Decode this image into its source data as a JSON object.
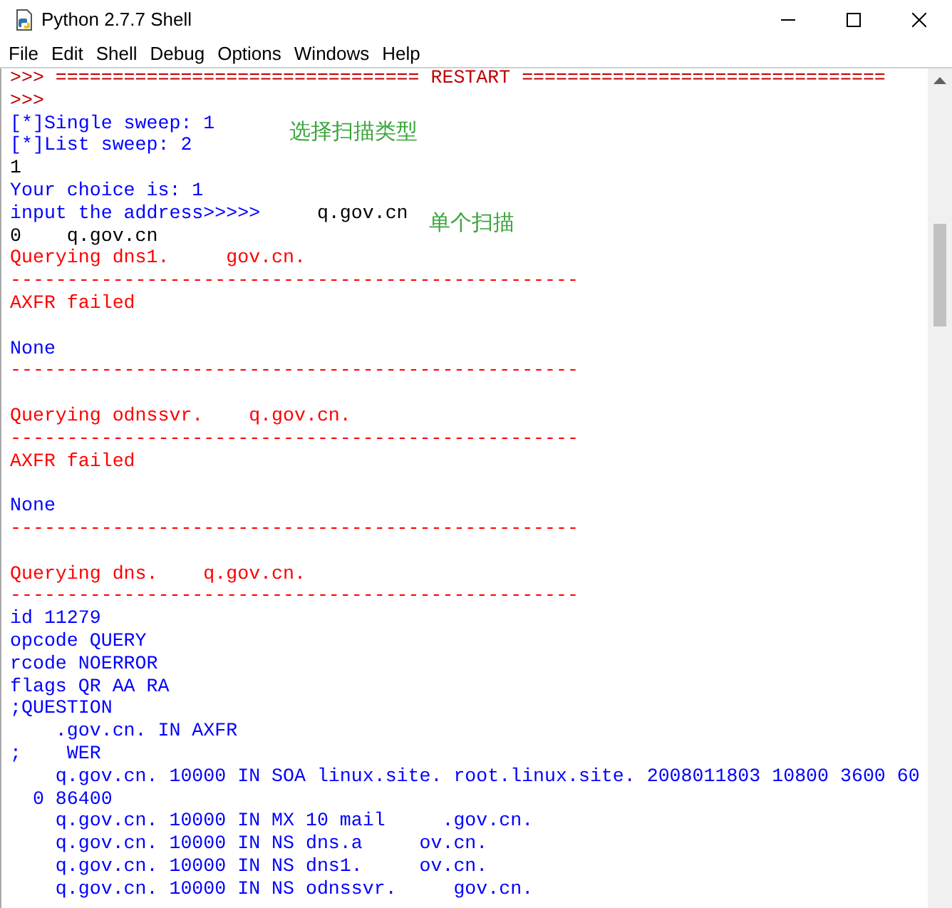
{
  "window": {
    "title": "Python 2.7.7 Shell"
  },
  "menu": [
    {
      "label": "File"
    },
    {
      "label": "Edit"
    },
    {
      "label": "Shell"
    },
    {
      "label": "Debug"
    },
    {
      "label": "Options"
    },
    {
      "label": "Windows"
    },
    {
      "label": "Help"
    }
  ],
  "lines": [
    {
      "segments": [
        {
          "kind": "prompt",
          "text": ">>> ================================ RESTART ================================"
        }
      ]
    },
    {
      "segments": [
        {
          "kind": "prompt",
          "text": ">>>"
        }
      ]
    },
    {
      "segments": [
        {
          "kind": "stdout",
          "text": "[*]Single sweep: 1"
        }
      ]
    },
    {
      "segments": [
        {
          "kind": "stdout",
          "text": "[*]List sweep: 2"
        }
      ]
    },
    {
      "segments": [
        {
          "kind": "input",
          "text": "1"
        }
      ]
    },
    {
      "segments": [
        {
          "kind": "stdout",
          "text": "Your choice is: 1"
        }
      ]
    },
    {
      "segments": [
        {
          "kind": "stdout",
          "text": "input the address>>>>> "
        },
        {
          "kind": "input",
          "text": "    q.gov.cn"
        }
      ]
    },
    {
      "segments": [
        {
          "kind": "input",
          "text": "0    q.gov.cn"
        }
      ]
    },
    {
      "segments": [
        {
          "kind": "stderr",
          "text": "Querying dns1.     gov.cn."
        }
      ]
    },
    {
      "segments": [
        {
          "kind": "stderr",
          "text": "--------------------------------------------------"
        }
      ]
    },
    {
      "segments": [
        {
          "kind": "stderr",
          "text": "AXFR failed"
        }
      ]
    },
    {
      "kind": "blank"
    },
    {
      "segments": [
        {
          "kind": "stdout",
          "text": "None"
        }
      ]
    },
    {
      "segments": [
        {
          "kind": "stderr",
          "text": "--------------------------------------------------"
        }
      ]
    },
    {
      "kind": "blank"
    },
    {
      "segments": [
        {
          "kind": "stderr",
          "text": "Querying odnssvr.    q.gov.cn."
        }
      ]
    },
    {
      "segments": [
        {
          "kind": "stderr",
          "text": "--------------------------------------------------"
        }
      ]
    },
    {
      "segments": [
        {
          "kind": "stderr",
          "text": "AXFR failed"
        }
      ]
    },
    {
      "kind": "blank"
    },
    {
      "segments": [
        {
          "kind": "stdout",
          "text": "None"
        }
      ]
    },
    {
      "segments": [
        {
          "kind": "stderr",
          "text": "--------------------------------------------------"
        }
      ]
    },
    {
      "kind": "blank"
    },
    {
      "segments": [
        {
          "kind": "stderr",
          "text": "Querying dns.    q.gov.cn."
        }
      ]
    },
    {
      "segments": [
        {
          "kind": "stderr",
          "text": "--------------------------------------------------"
        }
      ]
    },
    {
      "segments": [
        {
          "kind": "stdout",
          "text": "id 11279"
        }
      ]
    },
    {
      "segments": [
        {
          "kind": "stdout",
          "text": "opcode QUERY"
        }
      ]
    },
    {
      "segments": [
        {
          "kind": "stdout",
          "text": "rcode NOERROR"
        }
      ]
    },
    {
      "segments": [
        {
          "kind": "stdout",
          "text": "flags QR AA RA"
        }
      ]
    },
    {
      "segments": [
        {
          "kind": "stdout",
          "text": ";QUESTION"
        }
      ]
    },
    {
      "segments": [
        {
          "kind": "stdout",
          "text": "    .gov.cn. IN AXFR"
        }
      ]
    },
    {
      "segments": [
        {
          "kind": "stdout",
          "text": ";    WER"
        }
      ]
    },
    {
      "segments": [
        {
          "kind": "stdout",
          "text": "    q.gov.cn. 10000 IN SOA linux.site. root.linux.site. 2008011803 10800 3600 60"
        }
      ]
    },
    {
      "segments": [
        {
          "kind": "stdout",
          "text": "  0 86400"
        }
      ]
    },
    {
      "segments": [
        {
          "kind": "stdout",
          "text": "    q.gov.cn. 10000 IN MX 10 mail     .gov.cn."
        }
      ]
    },
    {
      "segments": [
        {
          "kind": "stdout",
          "text": "    q.gov.cn. 10000 IN NS dns.a     ov.cn."
        }
      ]
    },
    {
      "segments": [
        {
          "kind": "stdout",
          "text": "    q.gov.cn. 10000 IN NS dns1.     ov.cn."
        }
      ]
    },
    {
      "segments": [
        {
          "kind": "stdout",
          "text": "    q.gov.cn. 10000 IN NS odnssvr.     gov.cn."
        }
      ]
    }
  ],
  "annotations": [
    {
      "text": "选择扫描类型"
    },
    {
      "text": "单个扫描"
    }
  ]
}
